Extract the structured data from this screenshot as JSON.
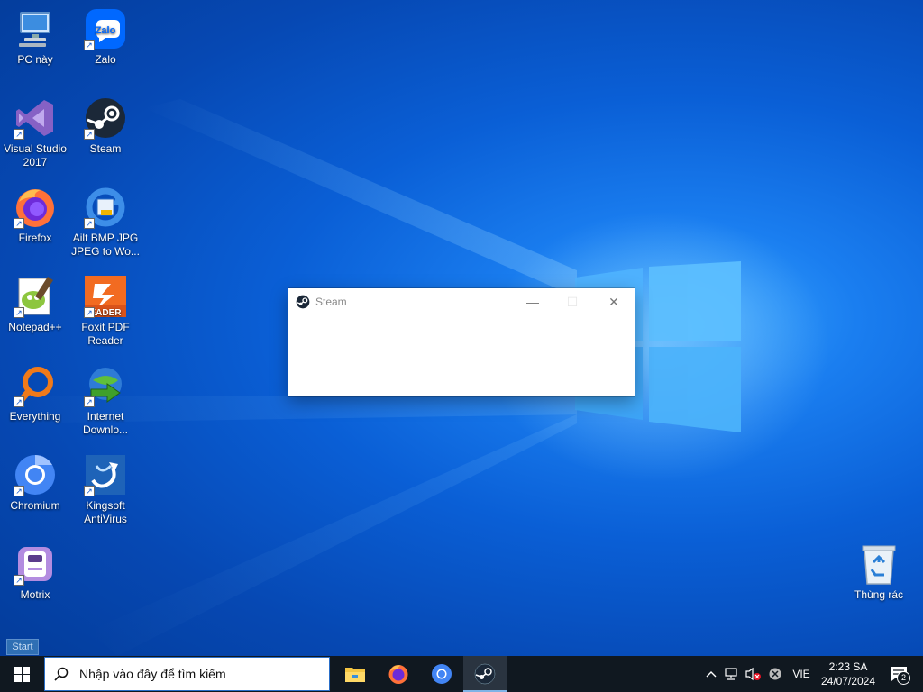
{
  "desktop": {
    "icons": [
      {
        "label": "PC này",
        "icon": "computer-icon"
      },
      {
        "label": "Zalo",
        "icon": "zalo-icon"
      },
      {
        "label": "Visual Studio 2017",
        "icon": "visual-studio-icon"
      },
      {
        "label": "Steam",
        "icon": "steam-icon"
      },
      {
        "label": "Firefox",
        "icon": "firefox-icon"
      },
      {
        "label": "Ailt BMP JPG JPEG to Wo...",
        "icon": "converter-icon"
      },
      {
        "label": "Notepad++",
        "icon": "notepadpp-icon"
      },
      {
        "label": "Foxit PDF Reader",
        "icon": "foxit-icon"
      },
      {
        "label": "Everything",
        "icon": "everything-search-icon"
      },
      {
        "label": "Internet Downlo...",
        "icon": "idm-icon"
      },
      {
        "label": "Chromium",
        "icon": "chromium-icon"
      },
      {
        "label": "Kingsoft AntiVirus",
        "icon": "antivirus-icon"
      },
      {
        "label": "Motrix",
        "icon": "motrix-icon"
      },
      {
        "label": "Thùng rác",
        "icon": "recycle-bin-icon"
      }
    ]
  },
  "steam_window": {
    "title": "Steam",
    "minimize": "—",
    "maximize": "☐",
    "close": "✕"
  },
  "start_tooltip": "Start",
  "taskbar": {
    "search_placeholder": "Nhập vào đây để tìm kiếm",
    "pinned": [
      "file-explorer-icon",
      "firefox-icon",
      "chromium-icon",
      "steam-icon"
    ],
    "language": "VIE",
    "time": "2:23 SA",
    "date": "24/07/2024",
    "notification_count": "2"
  },
  "colors": {
    "taskbar": "#101820",
    "accent": "#0a5fd6",
    "steam_blue": "#1b2838"
  }
}
